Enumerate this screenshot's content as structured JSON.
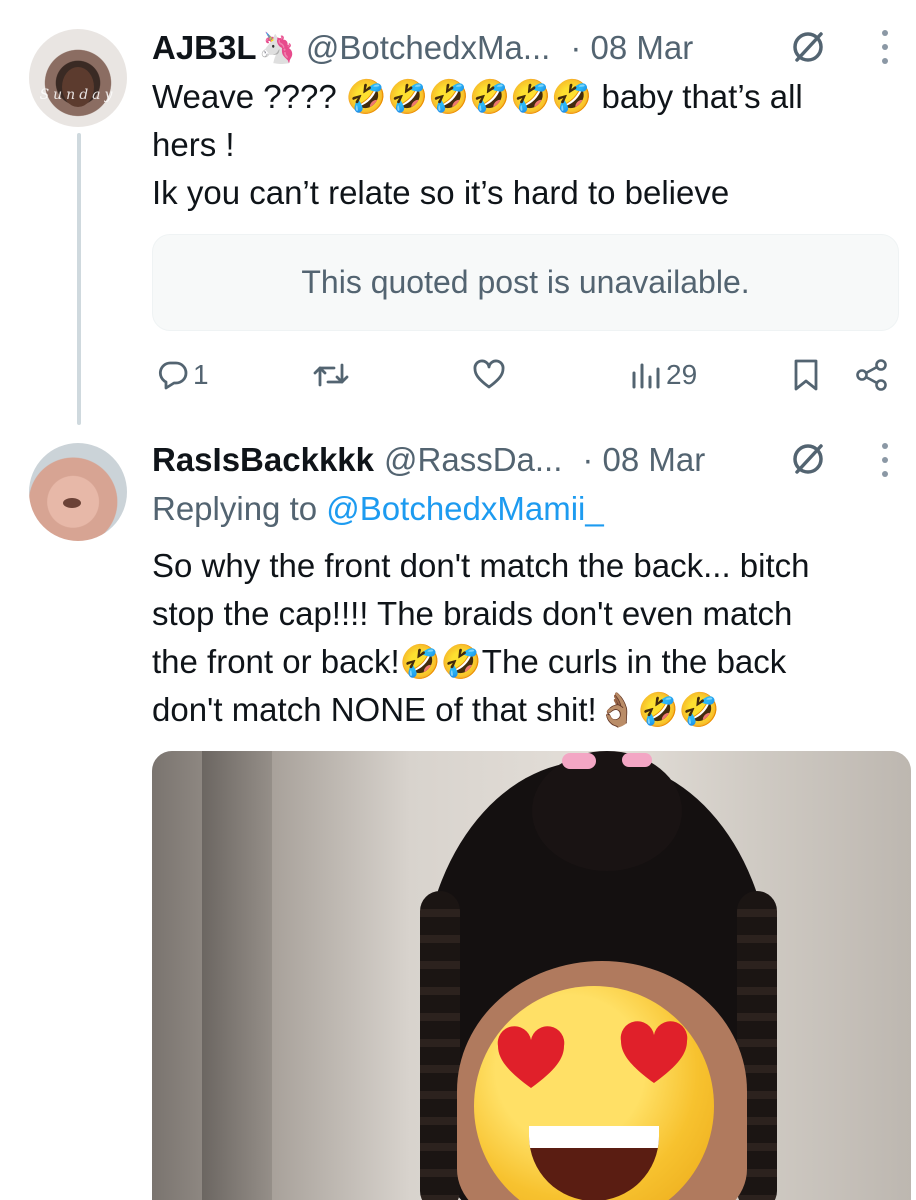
{
  "posts": [
    {
      "display_name": "AJB3L",
      "badge_emoji": "🦄",
      "handle": "@BotchedxMa...",
      "date": "· 08 Mar",
      "text_lines": [
        "Weave ???? 🤣🤣🤣🤣🤣🤣 baby that’s all",
        "hers !",
        "Ik you can’t relate so it’s hard to believe"
      ],
      "quoted_post_text": "This quoted post is unavailable.",
      "actions": {
        "reply_count": "1",
        "repost_count": "",
        "like_count": "",
        "views_count": "29"
      }
    },
    {
      "display_name": "RasIsBackkkk",
      "handle": "@RassDa...",
      "date": "· 08 Mar",
      "replying_to_label": "Replying to",
      "replying_to_handle": "@BotchedxMamii_",
      "text_lines": [
        "So why the front don't match the back... bitch",
        "stop the cap!!!! The braids don't even match",
        "the front or back!🤣🤣The curls in the back",
        "don't match NONE of that shit!👌🏽🤣🤣"
      ],
      "media_overlay_emoji": "😍"
    }
  ],
  "icons": {
    "hidden_reply": "slash-circle",
    "more": "vertical-ellipsis",
    "reply": "speech-bubble",
    "repost": "two-arrows",
    "like": "heart",
    "views": "bar-chart",
    "bookmark": "bookmark",
    "share": "share-nodes"
  },
  "colors": {
    "text": "#0f1419",
    "muted": "#536471",
    "link": "#1d9bf0",
    "thread_line": "#cfd9de",
    "quote_bg": "#f7f9f9"
  }
}
